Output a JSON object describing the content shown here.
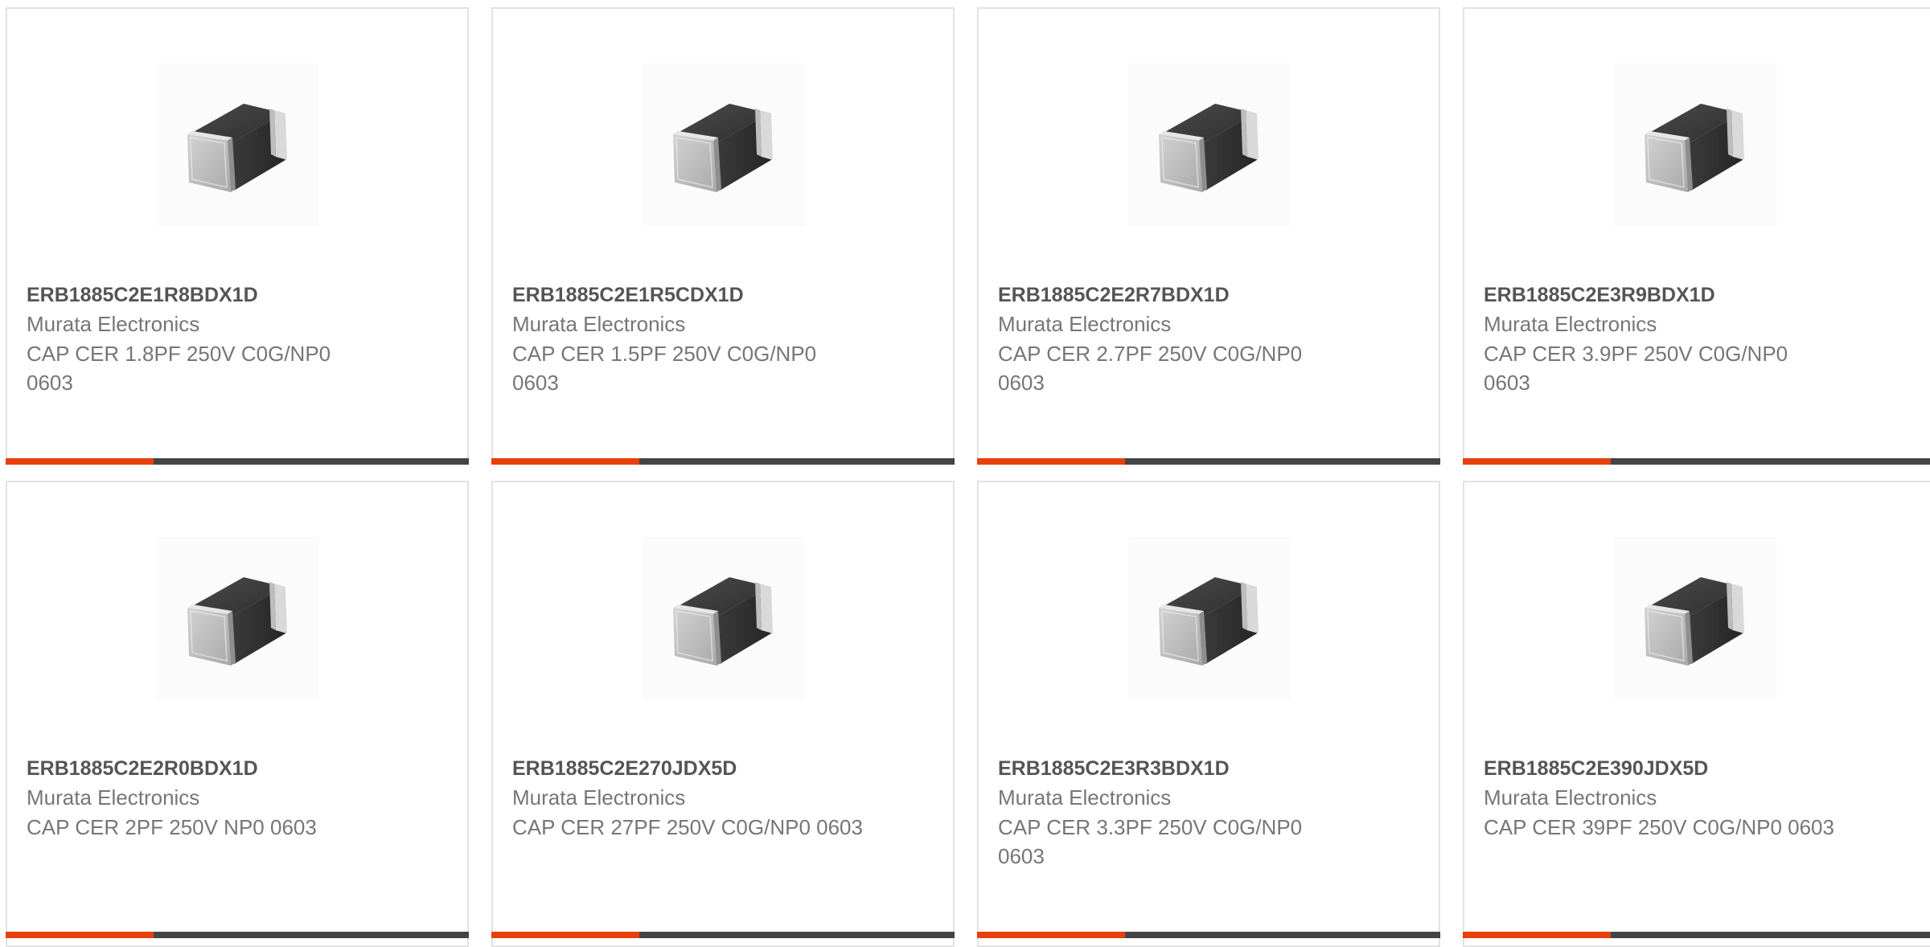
{
  "colors": {
    "accent": "#e8400c",
    "bar": "#444444",
    "border": "#e2e2e2"
  },
  "products": [
    {
      "part_number": "ERB1885C2E1R8BDX1D",
      "manufacturer": "Murata Electronics",
      "description": "CAP CER 1.8PF 250V C0G/NP0 0603",
      "image_icon": "ceramic-capacitor-chip-icon"
    },
    {
      "part_number": "ERB1885C2E1R5CDX1D",
      "manufacturer": "Murata Electronics",
      "description": "CAP CER 1.5PF 250V C0G/NP0 0603",
      "image_icon": "ceramic-capacitor-chip-icon"
    },
    {
      "part_number": "ERB1885C2E2R7BDX1D",
      "manufacturer": "Murata Electronics",
      "description": "CAP CER 2.7PF 250V C0G/NP0 0603",
      "image_icon": "ceramic-capacitor-chip-icon"
    },
    {
      "part_number": "ERB1885C2E3R9BDX1D",
      "manufacturer": "Murata Electronics",
      "description": "CAP CER 3.9PF 250V C0G/NP0 0603",
      "image_icon": "ceramic-capacitor-chip-icon"
    },
    {
      "part_number": "ERB1885C2E2R0BDX1D",
      "manufacturer": "Murata Electronics",
      "description": "CAP CER 2PF 250V NP0 0603",
      "image_icon": "ceramic-capacitor-chip-icon"
    },
    {
      "part_number": "ERB1885C2E270JDX5D",
      "manufacturer": "Murata Electronics",
      "description": "CAP CER 27PF 250V C0G/NP0 0603",
      "image_icon": "ceramic-capacitor-chip-icon"
    },
    {
      "part_number": "ERB1885C2E3R3BDX1D",
      "manufacturer": "Murata Electronics",
      "description": "CAP CER 3.3PF 250V C0G/NP0 0603",
      "image_icon": "ceramic-capacitor-chip-icon"
    },
    {
      "part_number": "ERB1885C2E390JDX5D",
      "manufacturer": "Murata Electronics",
      "description": "CAP CER 39PF 250V C0G/NP0 0603",
      "image_icon": "ceramic-capacitor-chip-icon"
    }
  ]
}
